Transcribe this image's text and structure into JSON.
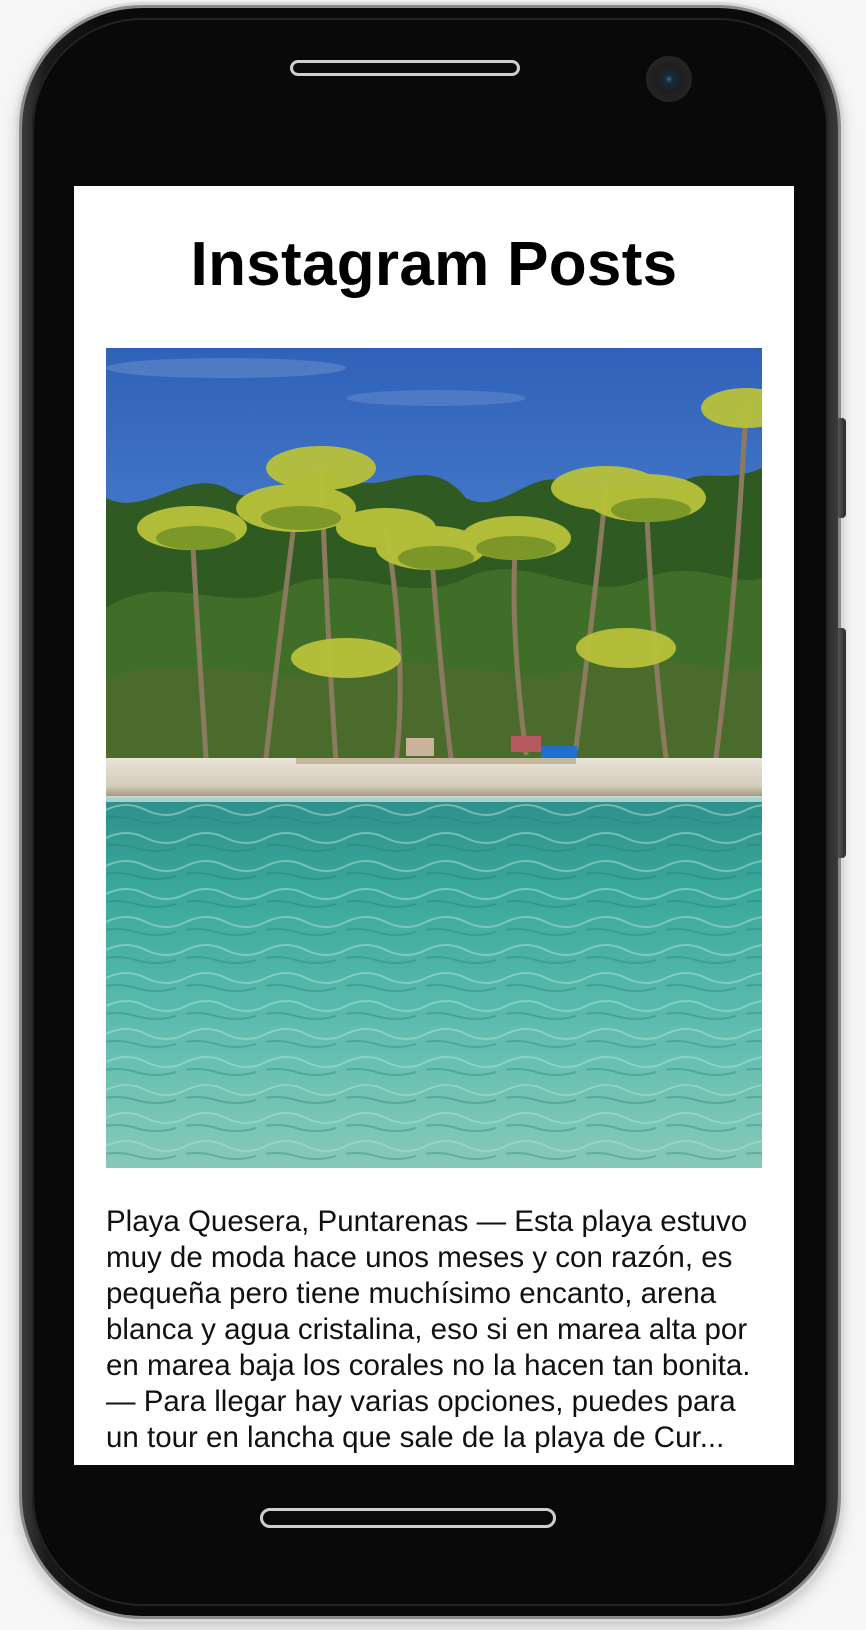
{
  "screen": {
    "title": "Instagram Posts"
  },
  "post": {
    "image_subject": "tropical beach with palm trees and turquoise water",
    "caption": "Playa Quesera, Puntarenas — Esta playa estuvo muy de moda hace unos meses y con razón, es pequeña pero tiene muchísimo encanto, arena blanca y agua cristalina, eso si en marea alta por en marea baja los corales no la hacen tan bonita. — Para llegar hay varias opciones, puedes para un tour en lancha que sale de la playa de Cur..."
  },
  "device": {
    "icons": [
      "speaker-grille-icon",
      "front-camera-icon",
      "home-button-icon"
    ],
    "colors": {
      "bezel": "#090909",
      "screen_bg": "#ffffff",
      "text": "#000000"
    }
  }
}
